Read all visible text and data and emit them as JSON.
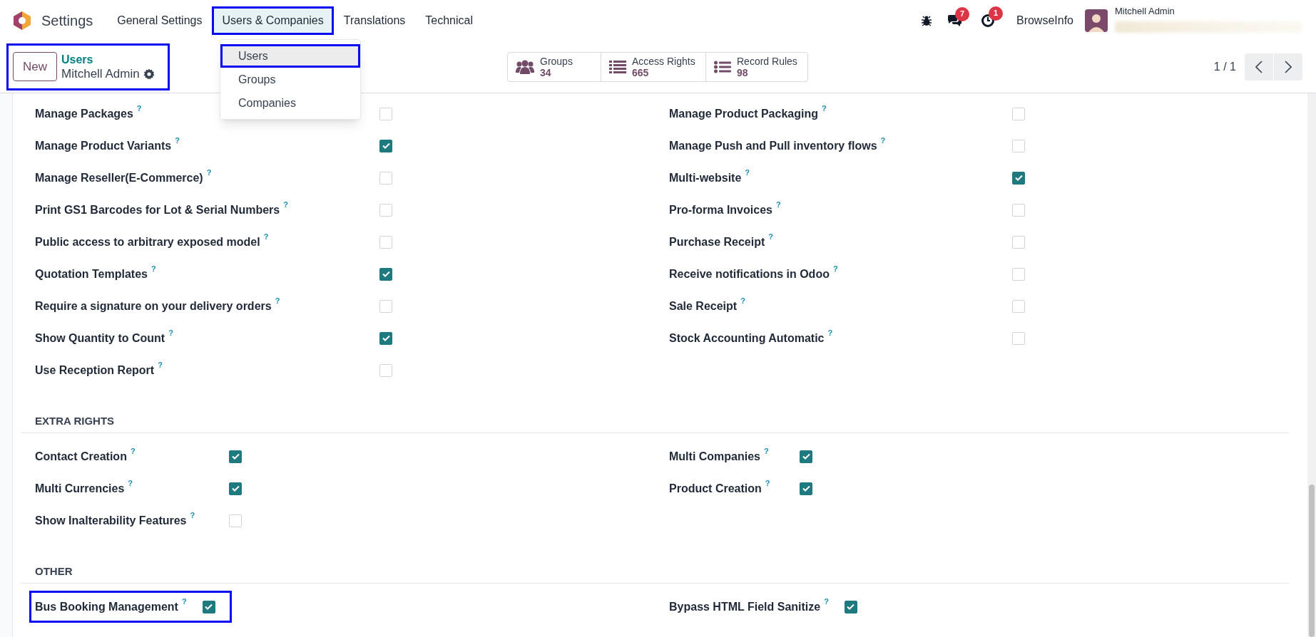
{
  "app": {
    "title": "Settings"
  },
  "menu": [
    {
      "label": "General Settings",
      "selected": false,
      "highlighted": false
    },
    {
      "label": "Users & Companies",
      "selected": true,
      "highlighted": true
    },
    {
      "label": "Translations",
      "selected": false,
      "highlighted": false
    },
    {
      "label": "Technical",
      "selected": false,
      "highlighted": false
    }
  ],
  "dropdown": [
    {
      "label": "Users",
      "selected": true,
      "highlighted": true
    },
    {
      "label": "Groups",
      "selected": false,
      "highlighted": false
    },
    {
      "label": "Companies",
      "selected": false,
      "highlighted": false
    }
  ],
  "systray": {
    "messages_badge": "7",
    "activities_badge": "1",
    "company": "BrowseInfo",
    "user": "Mitchell Admin"
  },
  "control_panel": {
    "new_button": "New",
    "breadcrumb": {
      "parent": "Users",
      "current": "Mitchell Admin",
      "highlighted": true
    },
    "stat_buttons": [
      {
        "kind": "groups",
        "label": "Groups",
        "value": "34"
      },
      {
        "kind": "list",
        "label": "Access Rights",
        "value": "665"
      },
      {
        "kind": "rules",
        "label": "Record Rules",
        "value": "98"
      }
    ],
    "pager": "1 / 1"
  },
  "sections": [
    {
      "left": [
        {
          "label": "Manage Packages",
          "help": "?",
          "checked": false,
          "highlighted": false
        },
        {
          "label": "Manage Product Variants",
          "help": "?",
          "checked": true,
          "highlighted": false
        },
        {
          "label": "Manage Reseller(E-Commerce)",
          "help": "?",
          "checked": false,
          "highlighted": false
        },
        {
          "label": "Print GS1 Barcodes for Lot & Serial Numbers",
          "help": "?",
          "checked": false,
          "highlighted": false
        },
        {
          "label": "Public access to arbitrary exposed model",
          "help": "?",
          "checked": false,
          "highlighted": false
        },
        {
          "label": "Quotation Templates",
          "help": "?",
          "checked": true,
          "highlighted": false
        },
        {
          "label": "Require a signature on your delivery orders",
          "help": "?",
          "checked": false,
          "highlighted": false
        },
        {
          "label": "Show Quantity to Count",
          "help": "?",
          "checked": true,
          "highlighted": false
        },
        {
          "label": "Use Reception Report",
          "help": "?",
          "checked": false,
          "highlighted": false
        }
      ],
      "right": [
        {
          "label": "Manage Product Packaging",
          "help": "?",
          "checked": false,
          "highlighted": false
        },
        {
          "label": "Manage Push and Pull inventory flows",
          "help": "?",
          "checked": false,
          "highlighted": false
        },
        {
          "label": "Multi-website",
          "help": "?",
          "checked": true,
          "highlighted": false
        },
        {
          "label": "Pro-forma Invoices",
          "help": "?",
          "checked": false,
          "highlighted": false
        },
        {
          "label": "Purchase Receipt",
          "help": "?",
          "checked": false,
          "highlighted": false
        },
        {
          "label": "Receive notifications in Odoo",
          "help": "?",
          "checked": false,
          "highlighted": false
        },
        {
          "label": "Sale Receipt",
          "help": "?",
          "checked": false,
          "highlighted": false
        },
        {
          "label": "Stock Accounting Automatic",
          "help": "?",
          "checked": false,
          "highlighted": false
        }
      ]
    },
    {
      "title": "EXTRA RIGHTS",
      "left": [
        {
          "label": "Contact Creation",
          "help": "?",
          "checked": true,
          "highlighted": false
        },
        {
          "label": "Multi Currencies",
          "help": "?",
          "checked": true,
          "highlighted": false
        },
        {
          "label": "Show Inalterability Features",
          "help": "?",
          "checked": false,
          "highlighted": false
        }
      ],
      "right": [
        {
          "label": "Multi Companies",
          "help": "?",
          "checked": true,
          "highlighted": false
        },
        {
          "label": "Product Creation",
          "help": "?",
          "checked": true,
          "highlighted": false
        }
      ]
    },
    {
      "title": "OTHER",
      "left": [
        {
          "label": "Bus Booking Management",
          "help": "?",
          "checked": true,
          "highlighted": true
        }
      ],
      "right": [
        {
          "label": "Bypass HTML Field Sanitize",
          "help": "?",
          "checked": true,
          "highlighted": false
        }
      ]
    }
  ]
}
